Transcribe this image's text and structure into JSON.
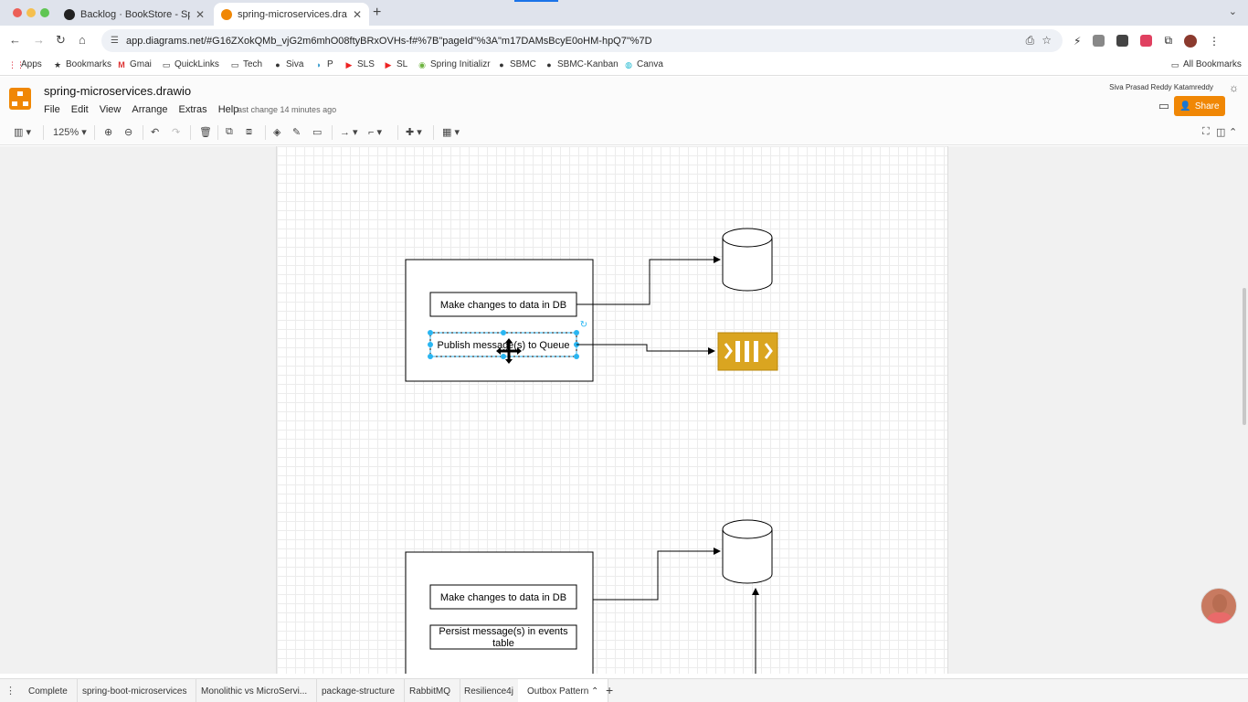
{
  "browser": {
    "tabs": [
      {
        "title": "Backlog · BookStore - Spring",
        "close": "✕"
      },
      {
        "title": "spring-microservices.drawio",
        "close": "✕"
      }
    ],
    "new_tab": "+",
    "tab_menu": "⌄",
    "url": "app.diagrams.net/#G16ZXokQMb_vjG2m6mhO08ftyBRxOVHs-f#%7B\"pageId\"%3A\"m17DAMsBcyE0oHM-hpQ7\"%7D"
  },
  "bookmarks": {
    "items": [
      {
        "label": "Apps",
        "icon": "apps-grid-icon"
      },
      {
        "label": "Bookmarks",
        "icon": "star-icon"
      },
      {
        "label": "Gmai",
        "icon": "gmail-icon"
      },
      {
        "label": "QuickLinks",
        "icon": "folder-icon"
      },
      {
        "label": "Tech",
        "icon": "folder-icon"
      },
      {
        "label": "Siva",
        "icon": "github-icon"
      },
      {
        "label": "P",
        "icon": "p-icon"
      },
      {
        "label": "SLS",
        "icon": "youtube-icon"
      },
      {
        "label": "SL",
        "icon": "youtube-icon"
      },
      {
        "label": "Spring Initializr",
        "icon": "spring-icon"
      },
      {
        "label": "SBMC",
        "icon": "github-icon"
      },
      {
        "label": "SBMC-Kanban",
        "icon": "github-icon"
      },
      {
        "label": "Canva",
        "icon": "canva-icon"
      }
    ],
    "all_bookmarks": "All Bookmarks"
  },
  "app": {
    "title": "spring-microservices.drawio",
    "menu": [
      "File",
      "Edit",
      "View",
      "Arrange",
      "Extras",
      "Help"
    ],
    "last_change": "Last change 14 minutes ago",
    "user": "Siva Prasad Reddy Katamreddy",
    "share": "Share"
  },
  "toolbar": {
    "zoom": "125%"
  },
  "diagram": {
    "top": {
      "box1": "Make changes to data in DB",
      "box2": "Publish message(s) to Queue"
    },
    "bottom": {
      "box1": "Make changes to data in DB",
      "box2_line1": "Persist message(s) in events",
      "box2_line2": "table"
    },
    "colors": {
      "queue": "#daa520",
      "selection": "#29b6f2",
      "accent": "#f08705"
    }
  },
  "pages": [
    "Complete",
    "spring-boot-microservices",
    "Monolithic vs MicroServi...",
    "package-structure",
    "RabbitMQ",
    "Resilience4j",
    "Outbox Pattern"
  ],
  "page_tab_caret": "⌃"
}
